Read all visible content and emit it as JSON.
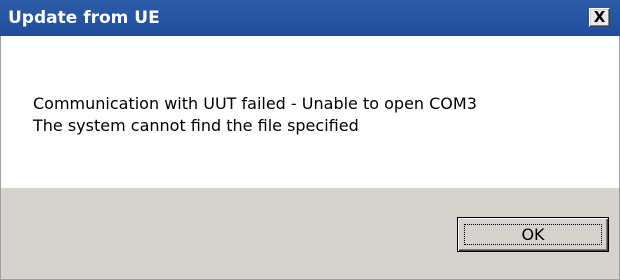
{
  "window": {
    "title": "Update from UE",
    "close_symbol": "X",
    "titlebar_color": "#2456a4"
  },
  "message": {
    "line1": "Communication with UUT failed - Unable to open COM3",
    "line2": "The system cannot find the file specified"
  },
  "buttons": {
    "ok_label": "OK"
  },
  "icons": {
    "close": "close-icon"
  }
}
